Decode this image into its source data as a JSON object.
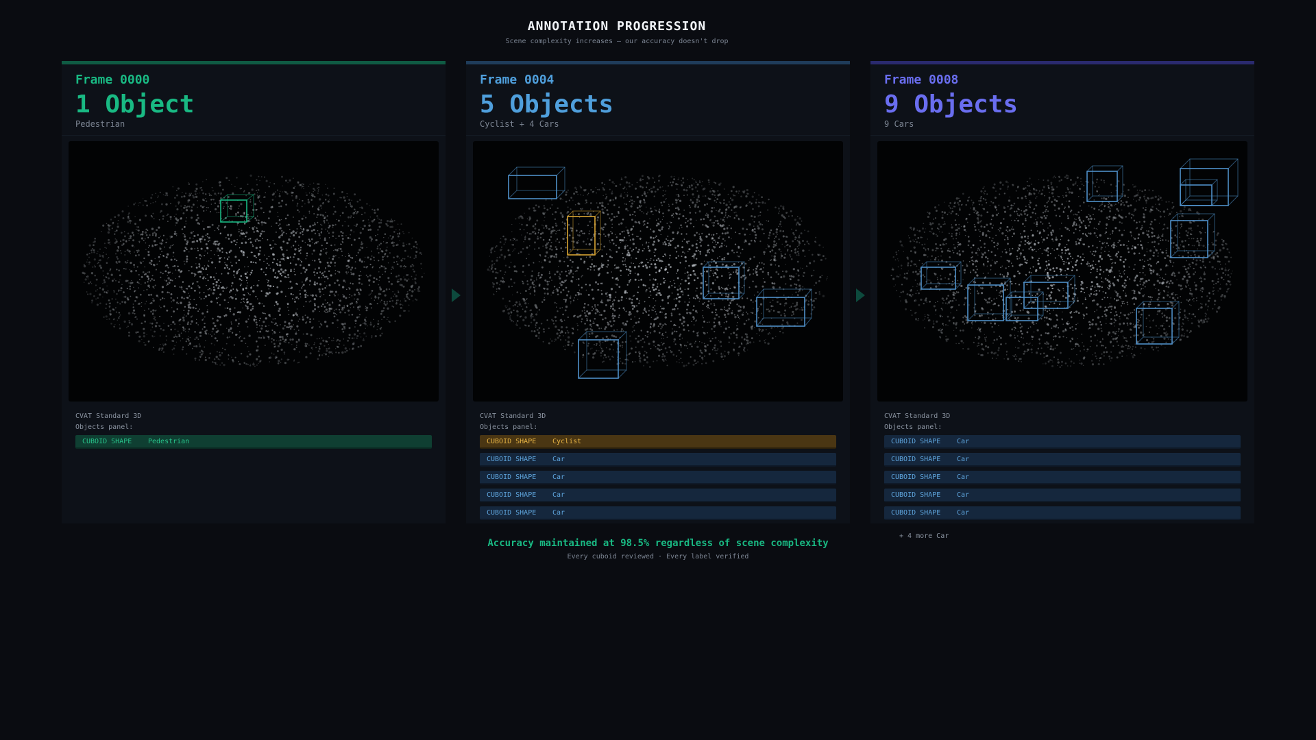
{
  "header": {
    "title": "ANNOTATION PROGRESSION",
    "subtitle": "Scene complexity increases — our accuracy doesn't drop"
  },
  "panels": [
    {
      "frame": "Frame 0000",
      "count": "1 Object",
      "description": "Pedestrian",
      "accent": "#19b983",
      "tool": "CVAT Standard 3D",
      "panel_label": "Objects panel:",
      "objects": [
        {
          "shape": "CUBOID SHAPE",
          "label": "Pedestrian",
          "kind": "ped"
        }
      ],
      "more": ""
    },
    {
      "frame": "Frame 0004",
      "count": "5 Objects",
      "description": "Cyclist + 4 Cars",
      "accent": "#4f9fdc",
      "tool": "CVAT Standard 3D",
      "panel_label": "Objects panel:",
      "objects": [
        {
          "shape": "CUBOID SHAPE",
          "label": "Cyclist",
          "kind": "cyclist"
        },
        {
          "shape": "CUBOID SHAPE",
          "label": "Car",
          "kind": "car"
        },
        {
          "shape": "CUBOID SHAPE",
          "label": "Car",
          "kind": "car"
        },
        {
          "shape": "CUBOID SHAPE",
          "label": "Car",
          "kind": "car"
        },
        {
          "shape": "CUBOID SHAPE",
          "label": "Car",
          "kind": "car"
        }
      ],
      "more": ""
    },
    {
      "frame": "Frame 0008",
      "count": "9 Objects",
      "description": "9 Cars",
      "accent": "#6a6ef0",
      "tool": "CVAT Standard 3D",
      "panel_label": "Objects panel:",
      "objects": [
        {
          "shape": "CUBOID SHAPE",
          "label": "Car",
          "kind": "car"
        },
        {
          "shape": "CUBOID SHAPE",
          "label": "Car",
          "kind": "car"
        },
        {
          "shape": "CUBOID SHAPE",
          "label": "Car",
          "kind": "car"
        },
        {
          "shape": "CUBOID SHAPE",
          "label": "Car",
          "kind": "car"
        },
        {
          "shape": "CUBOID SHAPE",
          "label": "Car",
          "kind": "car"
        }
      ],
      "more": "+ 4 more Car"
    }
  ],
  "footer": {
    "main": "Accuracy maintained at 98.5% regardless of scene complexity",
    "sub": "Every cuboid reviewed · Every label verified"
  },
  "colors": {
    "pedestrian": "#19b983",
    "cyclist": "#d9a433",
    "car": "#4f8fc8"
  }
}
